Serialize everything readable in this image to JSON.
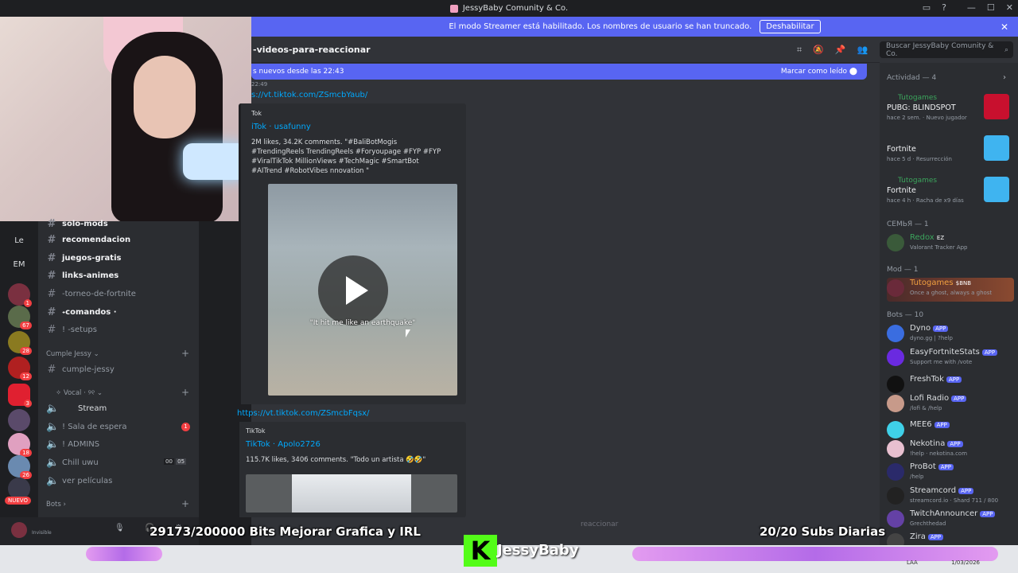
{
  "window": {
    "title": "JessyBaby Comunity & Co."
  },
  "banner": {
    "text": "El modo Streamer está habilitado. Los nombres de usuario se han truncado.",
    "button": "Deshabilitar"
  },
  "channel": {
    "name": "-videos-para-reaccionar"
  },
  "search": {
    "placeholder": "Buscar JessyBaby Comunity & Co."
  },
  "newbar": {
    "text": "s nuevos desde las 22:43",
    "mark_read": "Marcar como leído"
  },
  "messages": {
    "time": "22:49",
    "link1": "s://vt.tiktok.com/ZSmcbYaub/",
    "embed1": {
      "provider": "Tok",
      "title": "iTok · usafunny",
      "desc": "2M likes, 34.2K comments. \"#BaliBotMogis #TrendingReels TrendingReels #Foryoupage #FYP #FYP #ViralTikTok MillionViews #TechMagic #SmartBot #AITrend #RobotVibes nnovation \"",
      "caption": "\"It hit me like an earthquake\""
    },
    "link2": "https://vt.tiktok.com/ZSmcbFqsx/",
    "embed2": {
      "provider": "TikTok",
      "title": "TikTok · Apolo2726",
      "desc": "115.7K likes, 3406 comments. \"Todo un artista 🤣🤣\""
    }
  },
  "composer": {
    "placeholder": "reaccionar"
  },
  "sidebar": {
    "guild_labels": [
      "Le",
      "EM"
    ],
    "guild_badges": [
      "1",
      "67",
      "28",
      "12",
      "3",
      "18",
      "26",
      "NUEVO"
    ],
    "channels": [
      {
        "label": "solo-mods",
        "bright": true
      },
      {
        "label": "recomendacion",
        "bright": true
      },
      {
        "label": "juegos-gratis",
        "bright": true
      },
      {
        "label": "links-animes",
        "bright": true
      },
      {
        "label": "-torneo-de-fortnite",
        "bright": false
      },
      {
        "label": "˖comandos ·",
        "bright": true
      },
      {
        "label": "! -setups",
        "bright": false
      }
    ],
    "category1": "Cumple Jessy ⌄",
    "cumple_channel": "cumple-jessy",
    "category2": "✧ Vocal · ୨୧ ⌄",
    "voice": [
      {
        "label": "Stream"
      },
      {
        "label": "! Sala de espera",
        "badge": "1"
      },
      {
        "label": "! ADMINS"
      },
      {
        "label": "Chill uwu",
        "counts": [
          "00",
          "05"
        ]
      },
      {
        "label": "ver películas"
      }
    ],
    "category3": "Bots ›",
    "user_status": "Invisible"
  },
  "members": {
    "activity_header": "Actividad — 4",
    "activities": [
      {
        "who": "Tutogames",
        "game": "PUBG: BLINDSPOT",
        "sub": "hace 2 sem. · Nuevo jugador",
        "thumb_color": "#c8102e"
      },
      {
        "who": "",
        "game": "Fortnite",
        "sub": "hace 5 d · Resurrección",
        "thumb_color": "#3fb4f0"
      },
      {
        "who": "Tutogames",
        "game": "Fortnite",
        "sub": "hace 4 h · Racha de x9 días",
        "thumb_color": "#3fb4f0"
      }
    ],
    "group1": "СЕМЬЯ — 1",
    "redox": {
      "name": "Redox",
      "tag": "EZ",
      "status": "Valorant Tracker App"
    },
    "group2": "Mod — 1",
    "mod": {
      "name": "Tutogames",
      "tag": "$BNB",
      "status": "Once a ghost, always a ghost"
    },
    "group3": "Bots — 10",
    "bots": [
      {
        "name": "Dyno",
        "status": "dyno.gg | ?help",
        "color": "#3a6de0"
      },
      {
        "name": "EasyFortniteStats",
        "status": "Support me with /vote",
        "color": "#6a2ae0"
      },
      {
        "name": "FreshTok",
        "status": "",
        "color": "#111111"
      },
      {
        "name": "Lofi Radio",
        "status": "/lofi & /help",
        "color": "#c79a8a"
      },
      {
        "name": "MEE6",
        "status": "",
        "color": "#3fd0e8"
      },
      {
        "name": "Nekotina",
        "status": "!help · nekotina.com",
        "color": "#e8c0d0"
      },
      {
        "name": "ProBot",
        "status": "/help",
        "color": "#2a2a6a"
      },
      {
        "name": "Streamcord",
        "status": "streamcord.io · Shard 711 / 800",
        "color": "#222222"
      },
      {
        "name": "TwitchAnnouncer",
        "status": "Grechthedad",
        "color": "#6441a5"
      },
      {
        "name": "Zira",
        "status": "",
        "color": "#444444"
      }
    ],
    "app_label": "APP"
  },
  "overlay": {
    "bits": "29173/200000 Bits Mejorar Grafica y IRL",
    "subs": "20/20 Subs Diarias",
    "k_logo": "K",
    "streamer": "JessyBaby"
  },
  "taskbar": {
    "lang": "LAA",
    "date": "1/03/2026"
  }
}
